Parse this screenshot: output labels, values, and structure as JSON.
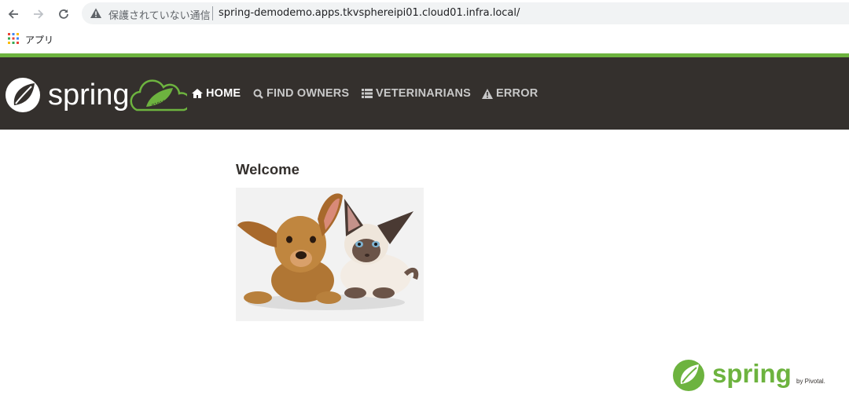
{
  "browser": {
    "security_label": "保護されていない通信",
    "url": "spring-demodemo.apps.tkvsphereipi01.cloud01.infra.local/",
    "bookmarks": {
      "apps_label": "アプリ"
    }
  },
  "header": {
    "logo_text": "spring",
    "nav": [
      {
        "label": "HOME",
        "icon": "home-icon",
        "active": true
      },
      {
        "label": "FIND OWNERS",
        "icon": "search-icon",
        "active": false
      },
      {
        "label": "VETERINARIANS",
        "icon": "list-icon",
        "active": false
      },
      {
        "label": "ERROR",
        "icon": "warning-icon",
        "active": false
      }
    ],
    "accent_color": "#6db33f",
    "bar_color": "#34302d"
  },
  "main": {
    "heading": "Welcome",
    "image": "pets-image"
  },
  "footer": {
    "logo_text": "spring",
    "byline": "by Pivotal."
  }
}
